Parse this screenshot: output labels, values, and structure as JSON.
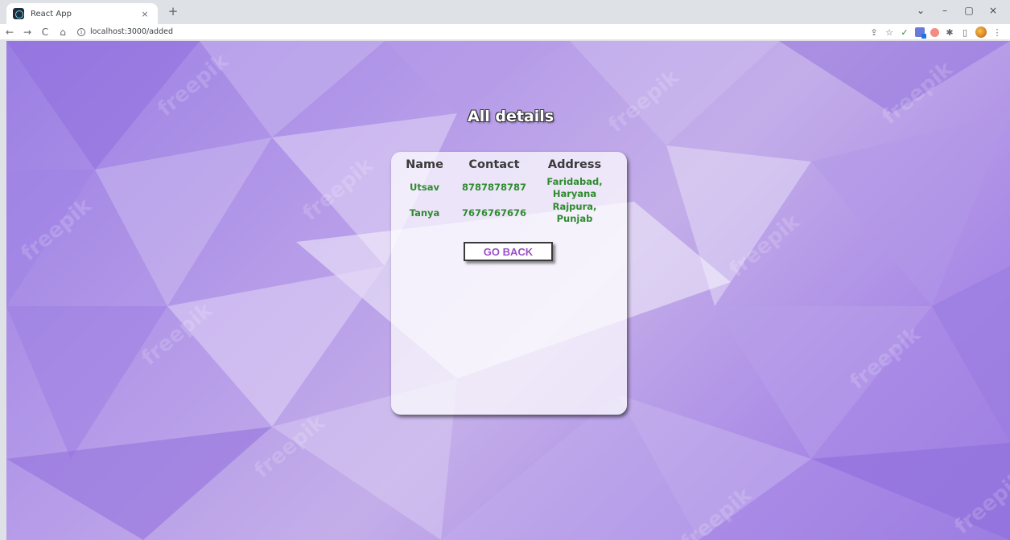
{
  "browser": {
    "tab_title": "React App",
    "tab_close": "×",
    "new_tab": "+",
    "url": "localhost:3000/added",
    "window_controls": [
      "⌄",
      "–",
      "▢",
      "×"
    ]
  },
  "page": {
    "title": "All details",
    "table": {
      "headers": [
        "Name",
        "Contact",
        "Address"
      ],
      "rows": [
        {
          "name": "Utsav",
          "contact": "8787878787",
          "address": "Faridabad, Haryana"
        },
        {
          "name": "Tanya",
          "contact": "7676767676",
          "address": "Rajpura, Punjab"
        }
      ]
    },
    "go_back_label": "GO BACK",
    "watermark": "freepik"
  },
  "colors": {
    "background": "#a88be6",
    "card": "#ffffff",
    "cell_text": "#2e8b2e",
    "button_text": "#9b4fc6"
  }
}
